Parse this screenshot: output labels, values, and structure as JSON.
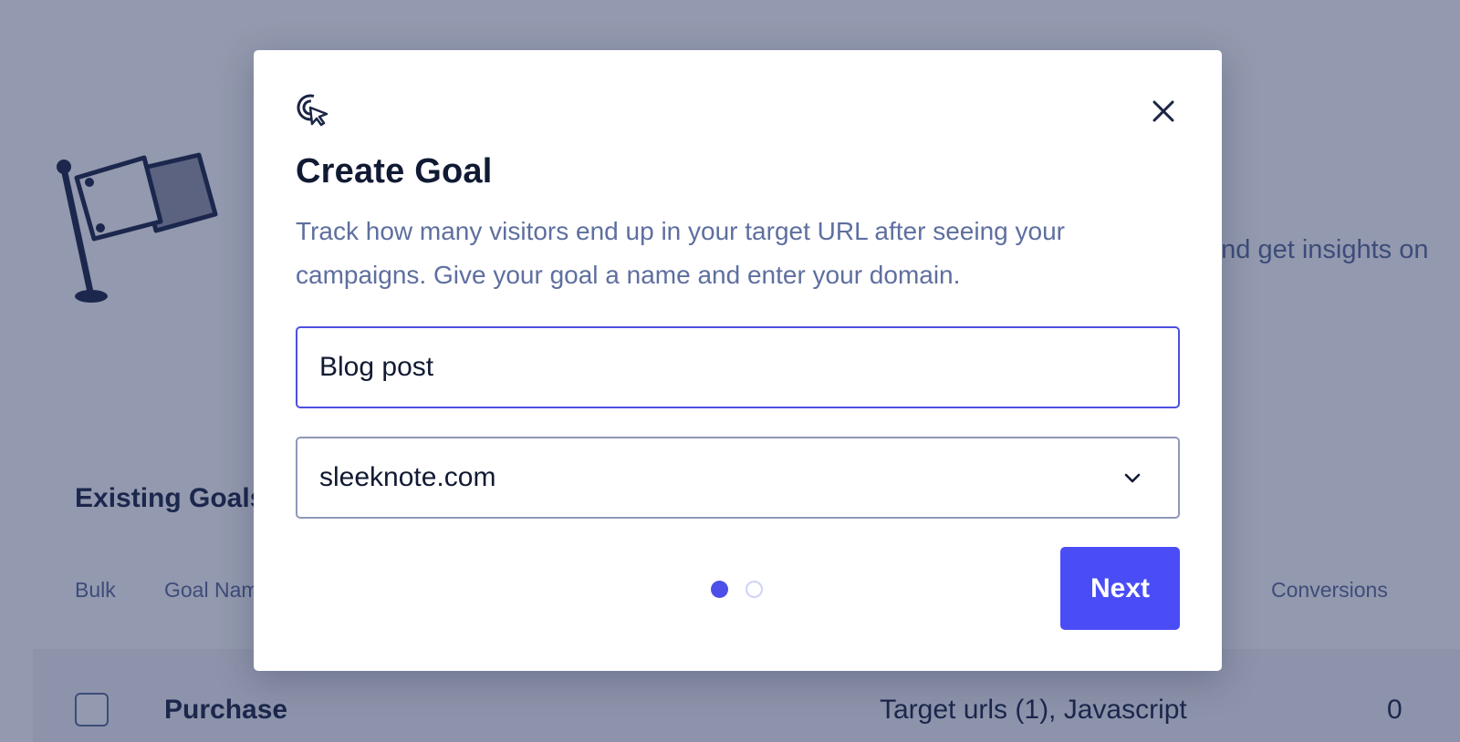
{
  "background": {
    "intro_fragment": "and get insights on",
    "goals_title": "Existing Goals",
    "columns": {
      "bulk": "Bulk",
      "goal_name": "Goal Name",
      "conversions": "Conversions"
    },
    "rows": [
      {
        "name": "Purchase",
        "type": "Target urls (1), Javascript",
        "conversions": "0"
      }
    ]
  },
  "modal": {
    "icon": "cursor-click-icon",
    "title": "Create Goal",
    "description": "Track how many visitors end up in your target URL after seeing your campaigns. Give your goal a name and enter your domain.",
    "name_value": "Blog post",
    "domain_value": "sleeknote.com",
    "step_current": 1,
    "step_total": 2,
    "next_label": "Next"
  },
  "colors": {
    "primary": "#4a4df5",
    "overlay": "#1e2a55",
    "text_dark": "#111a33",
    "text_muted": "#5e6f9f"
  }
}
